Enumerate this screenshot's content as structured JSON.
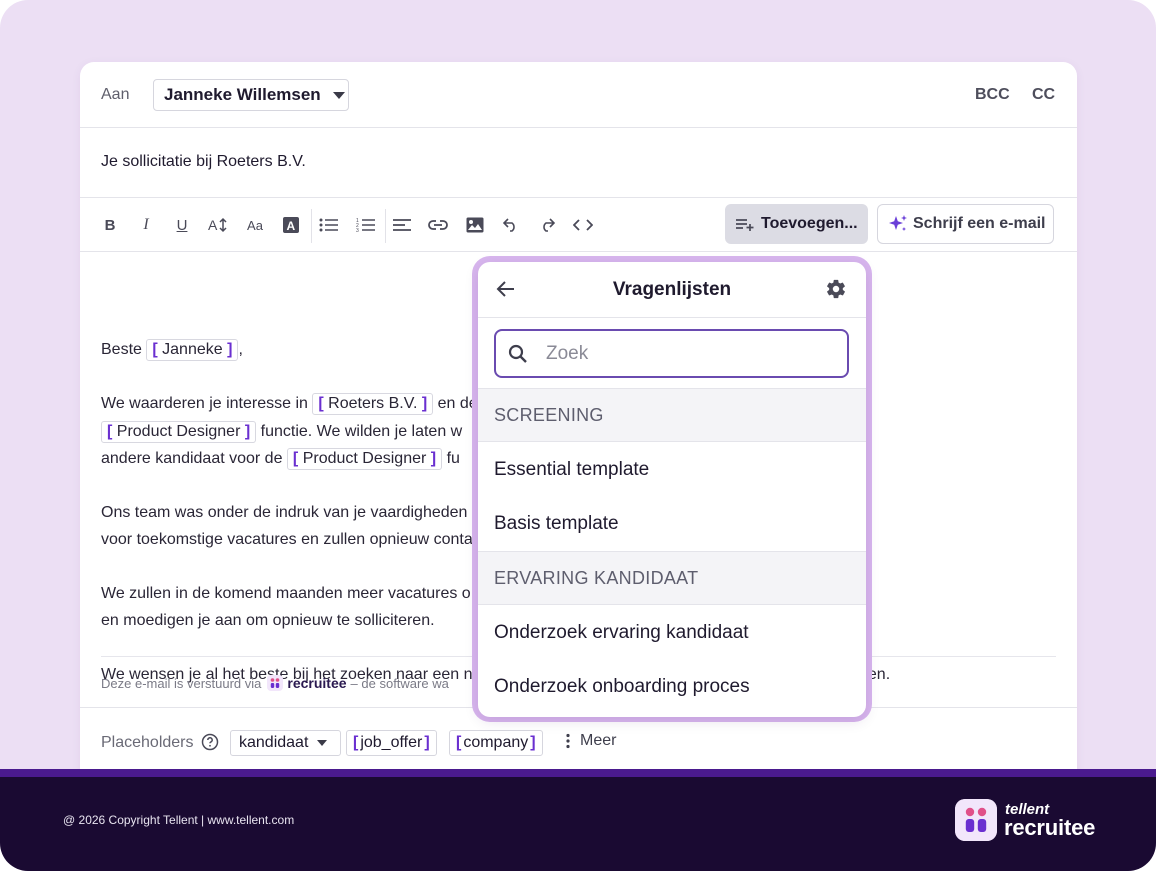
{
  "header": {
    "to_label": "Aan",
    "recipient": "Janneke Willemsen",
    "bcc": "BCC",
    "cc": "CC"
  },
  "subject": "Je sollicitatie bij Roeters B.V.",
  "toolbar": {
    "insert_label": "Toevoegen...",
    "write_label": "Schrijf een e-mail",
    "font_size_label": "Aa"
  },
  "body": {
    "greeting": "Beste",
    "greeting_ph": "Janneke",
    "p1_a": "We waarderen je interesse in",
    "p1_ph1": "Roeters B.V.",
    "p1_b": "en de",
    "p1_ph2": "Product Designer",
    "p1_c": "functie. We wilden je laten w",
    "p1_d": "andere kandidaat voor de",
    "p1_ph3": "Product Designer",
    "p1_e": "fu",
    "p2_a": "Ons team was onder de indruk van je vaardigheden",
    "p2_b": "voor toekomstige vacatures en zullen opnieuw conta",
    "p3_a": "We zullen in de komend maanden meer vacatures o",
    "p3_b": "en moedigen je aan om opnieuw te solliciteren.",
    "p4_a": "We wensen je al het beste bij het zoeken naar een n",
    "p4_b": "gen."
  },
  "signature": {
    "prefix": "Deze e-mail is verstuurd via",
    "brand": "recruitee",
    "suffix": "– de software wa"
  },
  "placeholders": {
    "label": "Placeholders",
    "select_value": "kandidaat",
    "chip1": "job_offer",
    "chip2": "company",
    "more": "Meer"
  },
  "panel": {
    "title": "Vragenlijsten",
    "search_placeholder": "Zoek",
    "sections": [
      {
        "title": "SCREENING",
        "items": [
          "Essential template",
          "Basis template"
        ]
      },
      {
        "title": "ERVARING KANDIDAAT",
        "items": [
          "Onderzoek ervaring kandidaat",
          "Onderzoek onboarding proces"
        ]
      }
    ]
  },
  "footer": {
    "copyright": "@ 2026 Copyright Tellent | www.tellent.com",
    "brand_small": "tellent",
    "brand_big": "recruitee"
  },
  "colors": {
    "background": "#ecdff4",
    "accent": "#6a2fd0",
    "footer_bg": "#1a0a32",
    "stripe": "#4a1a8e",
    "panel_glow": "#d8b6ee"
  }
}
